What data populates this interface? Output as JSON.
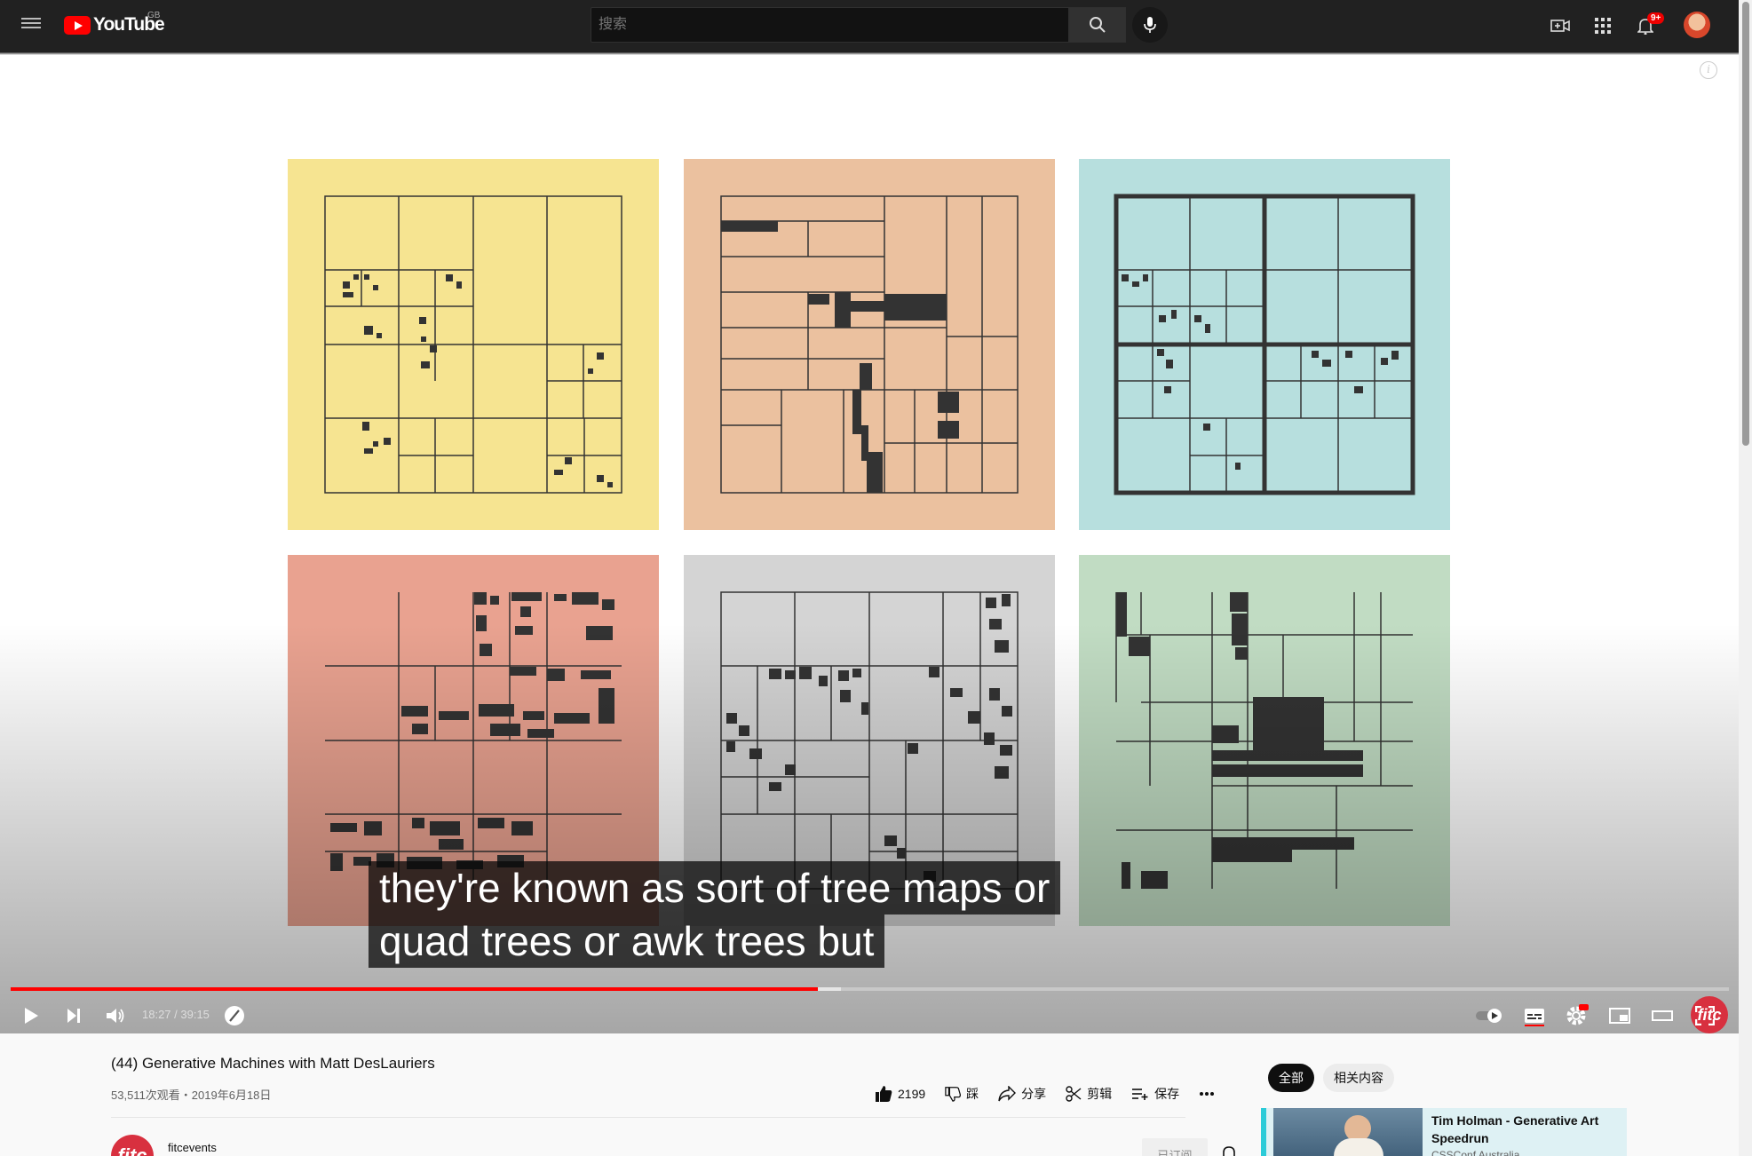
{
  "masthead": {
    "logo_text": "YouTube",
    "region": "GB",
    "search_placeholder": "搜索",
    "notifications_count": "9+"
  },
  "player": {
    "captions": [
      "they're known as sort of tree maps or",
      "quad trees or awk trees but"
    ],
    "current_time": "18:27",
    "duration": "39:15",
    "time_display": "18:27 / 39:15",
    "progress_fraction": 0.47,
    "buffer_fraction": 0.483,
    "watermark": "fitc",
    "tile_colors": [
      "#f6e491",
      "#ebc19f",
      "#b7dfde",
      "#e9a290",
      "#d4d4d4",
      "#c1dcc3"
    ]
  },
  "video": {
    "title": "(44) Generative Machines with Matt DesLauriers",
    "meta": "53,511次观看・2019年6月18日",
    "likes": "2199",
    "dislike_label": "踩",
    "share_label": "分享",
    "clip_label": "剪辑",
    "save_label": "保存"
  },
  "channel": {
    "name": "fitcevents",
    "avatar_text": "fitc",
    "subscribe_label": "已订阅"
  },
  "sidebar": {
    "chips": [
      "全部",
      "相关内容"
    ],
    "recommendation": {
      "title": "Tim Holman - Generative Art Speedrun",
      "channel": "CSSConf Australia"
    }
  }
}
